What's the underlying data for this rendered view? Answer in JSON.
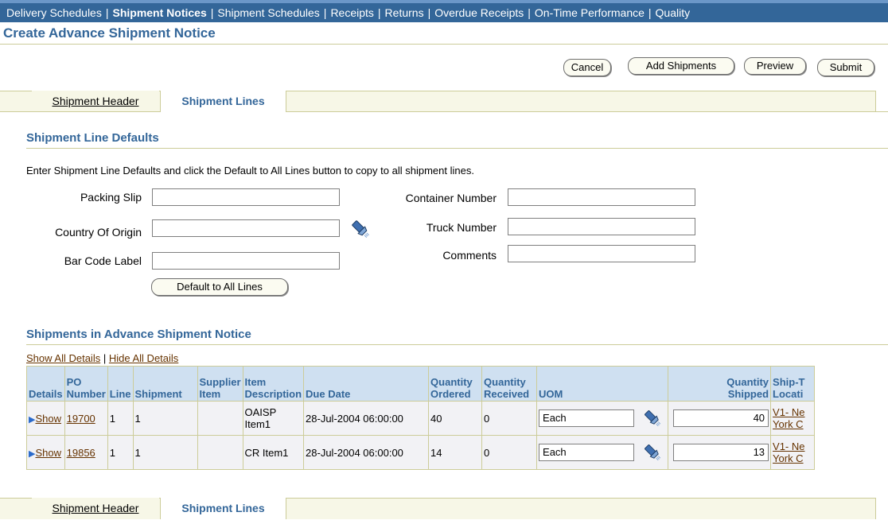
{
  "topnav": {
    "items": [
      {
        "label": "Delivery Schedules",
        "active": false
      },
      {
        "label": "Shipment Notices",
        "active": true
      },
      {
        "label": "Shipment Schedules",
        "active": false
      },
      {
        "label": "Receipts",
        "active": false
      },
      {
        "label": "Returns",
        "active": false
      },
      {
        "label": "Overdue Receipts",
        "active": false
      },
      {
        "label": "On-Time Performance",
        "active": false
      },
      {
        "label": "Quality",
        "active": false
      }
    ],
    "separator": "|"
  },
  "page_title": "Create Advance Shipment Notice",
  "actions": {
    "cancel": "Cancel",
    "add_shipments": "Add Shipments",
    "preview": "Preview",
    "submit": "Submit"
  },
  "tabs": {
    "header": "Shipment Header",
    "lines": "Shipment Lines"
  },
  "defaults": {
    "heading": "Shipment Line Defaults",
    "instructions": "Enter Shipment Line Defaults and click the Default to All Lines button to copy to all shipment lines.",
    "packing_slip": {
      "label": "Packing Slip",
      "value": ""
    },
    "country_of_origin": {
      "label": "Country Of Origin",
      "value": ""
    },
    "bar_code_label": {
      "label": "Bar Code Label",
      "value": ""
    },
    "container_number": {
      "label": "Container Number",
      "value": ""
    },
    "truck_number": {
      "label": "Truck Number",
      "value": ""
    },
    "comments": {
      "label": "Comments",
      "value": ""
    },
    "default_button": "Default to All Lines"
  },
  "shipments": {
    "heading": "Shipments in Advance Shipment Notice",
    "show_all": "Show All Details",
    "hide_all": "Hide All Details",
    "link_sep": "|",
    "columns": {
      "details": "Details",
      "po_number": [
        "PO",
        "Number"
      ],
      "line": "Line",
      "shipment": "Shipment",
      "supplier_item": [
        "Supplier",
        "Item"
      ],
      "item_description": [
        "Item",
        "Description"
      ],
      "due_date": "Due Date",
      "quantity_ordered": [
        "Quantity",
        "Ordered"
      ],
      "quantity_received": [
        "Quantity",
        "Received"
      ],
      "uom": "UOM",
      "quantity_shipped": [
        "Quantity",
        "Shipped"
      ],
      "ship_to_location": [
        "Ship-T",
        "Locati"
      ]
    },
    "rows": [
      {
        "show": "Show",
        "po_number": "19700",
        "line": "1",
        "shipment": "1",
        "supplier_item": "",
        "item_description": [
          "OAISP",
          "Item1"
        ],
        "due_date": "28-Jul-2004 06:00:00",
        "quantity_ordered": "40",
        "quantity_received": "0",
        "uom": "Each",
        "quantity_shipped": "40",
        "ship_to": [
          "V1- Ne",
          "York C"
        ]
      },
      {
        "show": "Show",
        "po_number": "19856",
        "line": "1",
        "shipment": "1",
        "supplier_item": "",
        "item_description": [
          "CR Item1"
        ],
        "due_date": "28-Jul-2004 06:00:00",
        "quantity_ordered": "14",
        "quantity_received": "0",
        "uom": "Each",
        "quantity_shipped": "13",
        "ship_to": [
          "V1- Ne",
          "York C"
        ]
      }
    ]
  }
}
